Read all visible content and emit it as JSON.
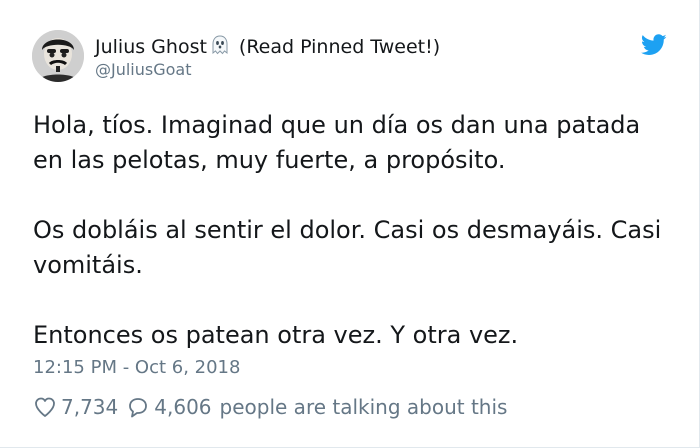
{
  "author": {
    "display_name": "Julius Ghost",
    "name_suffix": "(Read Pinned Tweet!)",
    "handle": "@JuliusGoat",
    "name_emoji": "ghost-icon",
    "avatar": "avatar"
  },
  "tweet": {
    "paragraphs": [
      "Hola, tíos. Imaginad que un día os dan una patada en las pelotas, muy fuerte, a propósito.",
      "Os dobláis al sentir el dolor. Casi os desmayáis. Casi vomitáis.",
      "Entonces os patean otra vez. Y otra vez."
    ],
    "timestamp": "12:15 PM - Oct 6, 2018"
  },
  "stats": {
    "likes": "7,734",
    "replies": "4,606",
    "talking_label": "people are talking about this"
  },
  "icons": {
    "brand": "twitter-bird-icon",
    "like": "heart-icon",
    "reply": "reply-bubble-icon"
  },
  "colors": {
    "brand": "#1da1f2",
    "text": "#14171a",
    "secondary": "#657786"
  }
}
